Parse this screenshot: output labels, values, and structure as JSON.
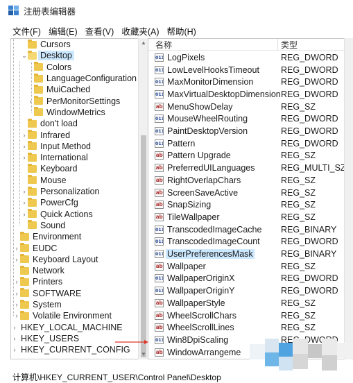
{
  "window": {
    "title": "注册表编辑器"
  },
  "menu": [
    "文件(F)",
    "编辑(E)",
    "查看(V)",
    "收藏夹(A)",
    "帮助(H)"
  ],
  "tree": [
    {
      "label": "Cursors",
      "level": 1,
      "expander": "",
      "icon": "folder-icon",
      "selected": false
    },
    {
      "label": "Desktop",
      "level": 1,
      "expander": "v",
      "icon": "folder-open-icon",
      "selected": true
    },
    {
      "label": "Colors",
      "level": 2,
      "expander": "",
      "icon": "folder-icon",
      "selected": false
    },
    {
      "label": "LanguageConfiguration",
      "level": 2,
      "expander": "",
      "icon": "folder-icon",
      "selected": false
    },
    {
      "label": "MuiCached",
      "level": 2,
      "expander": "",
      "icon": "folder-icon",
      "selected": false
    },
    {
      "label": "PerMonitorSettings",
      "level": 2,
      "expander": ">",
      "icon": "folder-icon",
      "selected": false
    },
    {
      "label": "WindowMetrics",
      "level": 2,
      "expander": "",
      "icon": "folder-icon",
      "selected": false
    },
    {
      "label": "don't load",
      "level": 1,
      "expander": "",
      "icon": "folder-icon",
      "selected": false
    },
    {
      "label": "Infrared",
      "level": 1,
      "expander": ">",
      "icon": "folder-icon",
      "selected": false
    },
    {
      "label": "Input Method",
      "level": 1,
      "expander": ">",
      "icon": "folder-icon",
      "selected": false
    },
    {
      "label": "International",
      "level": 1,
      "expander": ">",
      "icon": "folder-icon",
      "selected": false
    },
    {
      "label": "Keyboard",
      "level": 1,
      "expander": "",
      "icon": "folder-icon",
      "selected": false
    },
    {
      "label": "Mouse",
      "level": 1,
      "expander": "",
      "icon": "folder-icon",
      "selected": false
    },
    {
      "label": "Personalization",
      "level": 1,
      "expander": ">",
      "icon": "folder-icon",
      "selected": false
    },
    {
      "label": "PowerCfg",
      "level": 1,
      "expander": ">",
      "icon": "folder-icon",
      "selected": false
    },
    {
      "label": "Quick Actions",
      "level": 1,
      "expander": ">",
      "icon": "folder-icon",
      "selected": false
    },
    {
      "label": "Sound",
      "level": 1,
      "expander": "",
      "icon": "folder-icon",
      "selected": false
    },
    {
      "label": "Environment",
      "level": 0,
      "expander": "",
      "icon": "folder-icon",
      "selected": false
    },
    {
      "label": "EUDC",
      "level": 0,
      "expander": ">",
      "icon": "folder-icon",
      "selected": false
    },
    {
      "label": "Keyboard Layout",
      "level": 0,
      "expander": ">",
      "icon": "folder-icon",
      "selected": false
    },
    {
      "label": "Network",
      "level": 0,
      "expander": "",
      "icon": "folder-icon",
      "selected": false
    },
    {
      "label": "Printers",
      "level": 0,
      "expander": ">",
      "icon": "folder-icon",
      "selected": false
    },
    {
      "label": "SOFTWARE",
      "level": 0,
      "expander": ">",
      "icon": "folder-icon",
      "selected": false
    },
    {
      "label": "System",
      "level": 0,
      "expander": ">",
      "icon": "folder-icon",
      "selected": false
    },
    {
      "label": "Volatile Environment",
      "level": 0,
      "expander": ">",
      "icon": "folder-icon",
      "selected": false
    },
    {
      "label": "HKEY_LOCAL_MACHINE",
      "level": -1,
      "expander": ">",
      "icon": "",
      "selected": false
    },
    {
      "label": "HKEY_USERS",
      "level": -1,
      "expander": ">",
      "icon": "",
      "selected": false
    },
    {
      "label": "HKEY_CURRENT_CONFIG",
      "level": -1,
      "expander": ">",
      "icon": "",
      "selected": false
    }
  ],
  "columns": {
    "name": "名称",
    "type": "类型"
  },
  "values": [
    {
      "name": "LogPixels",
      "type": "REG_DWORD",
      "icon": "binary-value-icon",
      "selected": false
    },
    {
      "name": "LowLevelHooksTimeout",
      "type": "REG_DWORD",
      "icon": "binary-value-icon",
      "selected": false
    },
    {
      "name": "MaxMonitorDimension",
      "type": "REG_DWORD",
      "icon": "binary-value-icon",
      "selected": false
    },
    {
      "name": "MaxVirtualDesktopDimension",
      "type": "REG_DWORD",
      "icon": "binary-value-icon",
      "selected": false
    },
    {
      "name": "MenuShowDelay",
      "type": "REG_SZ",
      "icon": "string-value-icon",
      "selected": false
    },
    {
      "name": "MouseWheelRouting",
      "type": "REG_DWORD",
      "icon": "binary-value-icon",
      "selected": false
    },
    {
      "name": "PaintDesktopVersion",
      "type": "REG_DWORD",
      "icon": "binary-value-icon",
      "selected": false
    },
    {
      "name": "Pattern",
      "type": "REG_DWORD",
      "icon": "binary-value-icon",
      "selected": false
    },
    {
      "name": "Pattern Upgrade",
      "type": "REG_SZ",
      "icon": "string-value-icon",
      "selected": false
    },
    {
      "name": "PreferredUILanguages",
      "type": "REG_MULTI_SZ",
      "icon": "string-value-icon",
      "selected": false
    },
    {
      "name": "RightOverlapChars",
      "type": "REG_SZ",
      "icon": "string-value-icon",
      "selected": false
    },
    {
      "name": "ScreenSaveActive",
      "type": "REG_SZ",
      "icon": "string-value-icon",
      "selected": false
    },
    {
      "name": "SnapSizing",
      "type": "REG_SZ",
      "icon": "string-value-icon",
      "selected": false
    },
    {
      "name": "TileWallpaper",
      "type": "REG_SZ",
      "icon": "string-value-icon",
      "selected": false
    },
    {
      "name": "TranscodedImageCache",
      "type": "REG_BINARY",
      "icon": "binary-value-icon",
      "selected": false
    },
    {
      "name": "TranscodedImageCount",
      "type": "REG_DWORD",
      "icon": "binary-value-icon",
      "selected": false
    },
    {
      "name": "UserPreferencesMask",
      "type": "REG_BINARY",
      "icon": "binary-value-icon",
      "selected": true
    },
    {
      "name": "Wallpaper",
      "type": "REG_SZ",
      "icon": "string-value-icon",
      "selected": false
    },
    {
      "name": "WallpaperOriginX",
      "type": "REG_DWORD",
      "icon": "binary-value-icon",
      "selected": false
    },
    {
      "name": "WallpaperOriginY",
      "type": "REG_DWORD",
      "icon": "binary-value-icon",
      "selected": false
    },
    {
      "name": "WallpaperStyle",
      "type": "REG_SZ",
      "icon": "string-value-icon",
      "selected": false
    },
    {
      "name": "WheelScrollChars",
      "type": "REG_SZ",
      "icon": "string-value-icon",
      "selected": false
    },
    {
      "name": "WheelScrollLines",
      "type": "REG_SZ",
      "icon": "string-value-icon",
      "selected": false
    },
    {
      "name": "Win8DpiScaling",
      "type": "REG_DWORD",
      "icon": "binary-value-icon",
      "selected": false
    },
    {
      "name": "WindowArrangeme",
      "type": "",
      "icon": "string-value-icon",
      "selected": false
    }
  ],
  "status": {
    "path": "计算机\\HKEY_CURRENT_USER\\Control Panel\\Desktop"
  },
  "colors": {
    "selection": "#cce8ff",
    "folder": "#eec84f",
    "annotation_arrow": "#e0342a"
  }
}
